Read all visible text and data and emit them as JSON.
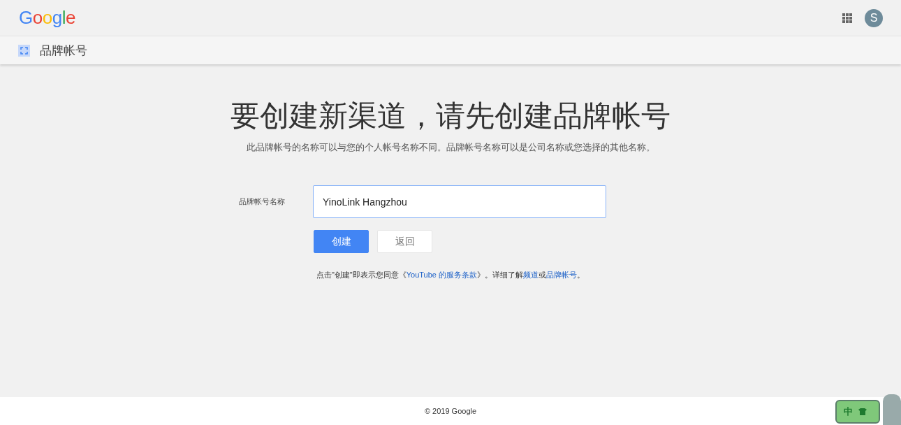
{
  "header": {
    "logo": "Google",
    "avatar_letter": "S"
  },
  "subbar": {
    "title": "品牌帐号"
  },
  "main": {
    "title": "要创建新渠道，请先创建品牌帐号",
    "subtitle": "此品牌帐号的名称可以与您的个人帐号名称不同。品牌帐号名称可以是公司名称或您选择的其他名称。",
    "field": {
      "label": "品牌帐号名称",
      "value": "YinoLink Hangzhou"
    },
    "buttons": [
      {
        "label": "创建",
        "kind": "primary"
      },
      {
        "label": "返回",
        "kind": "secondary"
      }
    ],
    "terms": [
      {
        "text": "点击\"创建\"即表示您同意《",
        "link": false
      },
      {
        "text": "YouTube 的服务条款",
        "link": true
      },
      {
        "text": "》。详细了解",
        "link": false
      },
      {
        "text": "频道",
        "link": true
      },
      {
        "text": "或",
        "link": false
      },
      {
        "text": "品牌帐号",
        "link": true
      },
      {
        "text": "。",
        "link": false
      }
    ]
  },
  "footer": {
    "copyright": "© 2019 Google"
  },
  "ime_toolbar": {
    "mode": "中"
  }
}
